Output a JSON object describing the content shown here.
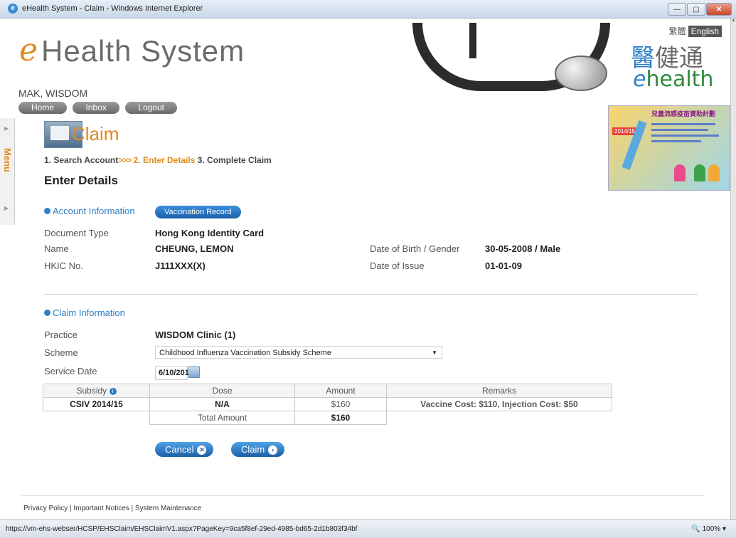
{
  "window": {
    "title": "eHealth System - Claim - Windows Internet Explorer",
    "min_glyph": "—",
    "max_glyph": "▢",
    "close_glyph": "✕"
  },
  "header": {
    "logo_e": "e",
    "logo_text": "Health System",
    "user_name": "MAK, WISDOM",
    "nav": [
      "Home",
      "Inbox",
      "Logout"
    ],
    "lang_tc": "繁體",
    "lang_en": "English",
    "brand_cn": "醫健通",
    "brand_cn_first": "醫",
    "brand_cn_rest": "健通",
    "brand_en_e": "e",
    "brand_en_rest": "health"
  },
  "banner": {
    "title": "兒童流感疫苗資助計劃",
    "year": "2014/15"
  },
  "menu": {
    "label": "Menu"
  },
  "claim": {
    "title": "Claim",
    "steps": {
      "step1": "1. Search Account",
      "arrows": ">>>",
      "step2": "2. Enter Details",
      "step3": "3. Complete Claim"
    },
    "heading": "Enter Details"
  },
  "account": {
    "section_label": "Account Information",
    "vaccination_button": "Vaccination Record",
    "doc_type_label": "Document Type",
    "doc_type_value": "Hong Kong Identity Card",
    "name_label": "Name",
    "name_value": "CHEUNG, LEMON",
    "hkic_label": "HKIC No.",
    "hkic_value": "J111XXX(X)",
    "dob_label": "Date of Birth / Gender",
    "dob_value": "30-05-2008 / Male",
    "issue_label": "Date of Issue",
    "issue_value": "01-01-09"
  },
  "claim_info": {
    "section_label": "Claim Information",
    "practice_label": "Practice",
    "practice_value": "WISDOM Clinic (1)",
    "scheme_label": "Scheme",
    "scheme_value": "Childhood Influenza Vaccination Subsidy Scheme",
    "service_date_label": "Service Date",
    "service_date_value": "6/10/2014"
  },
  "subsidy_table": {
    "headers": [
      "Subsidy",
      "Dose",
      "Amount",
      "Remarks"
    ],
    "row": {
      "subsidy": "CSIV 2014/15",
      "dose": "N/A",
      "amount": "$160",
      "remarks": "Vaccine Cost: $110, Injection Cost: $50"
    },
    "total_label": "Total Amount",
    "total_value": "$160"
  },
  "actions": {
    "cancel": "Cancel",
    "cancel_icon": "✕",
    "claim": "Claim",
    "claim_icon": "›"
  },
  "footer": {
    "text": "Privacy Policy | Important Notices | System Maintenance"
  },
  "status": {
    "url": "https://vm-ehs-webser/HCSP/EHSClaim/EHSClaimV1.aspx?PageKey=9ca5f8ef-29ed-4985-bd65-2d1b803f34bf",
    "zoom": "100%"
  },
  "colors": {
    "accent_orange": "#e08a1e",
    "link_blue": "#2e7fc7",
    "button_blue": "#1c5fa8"
  }
}
